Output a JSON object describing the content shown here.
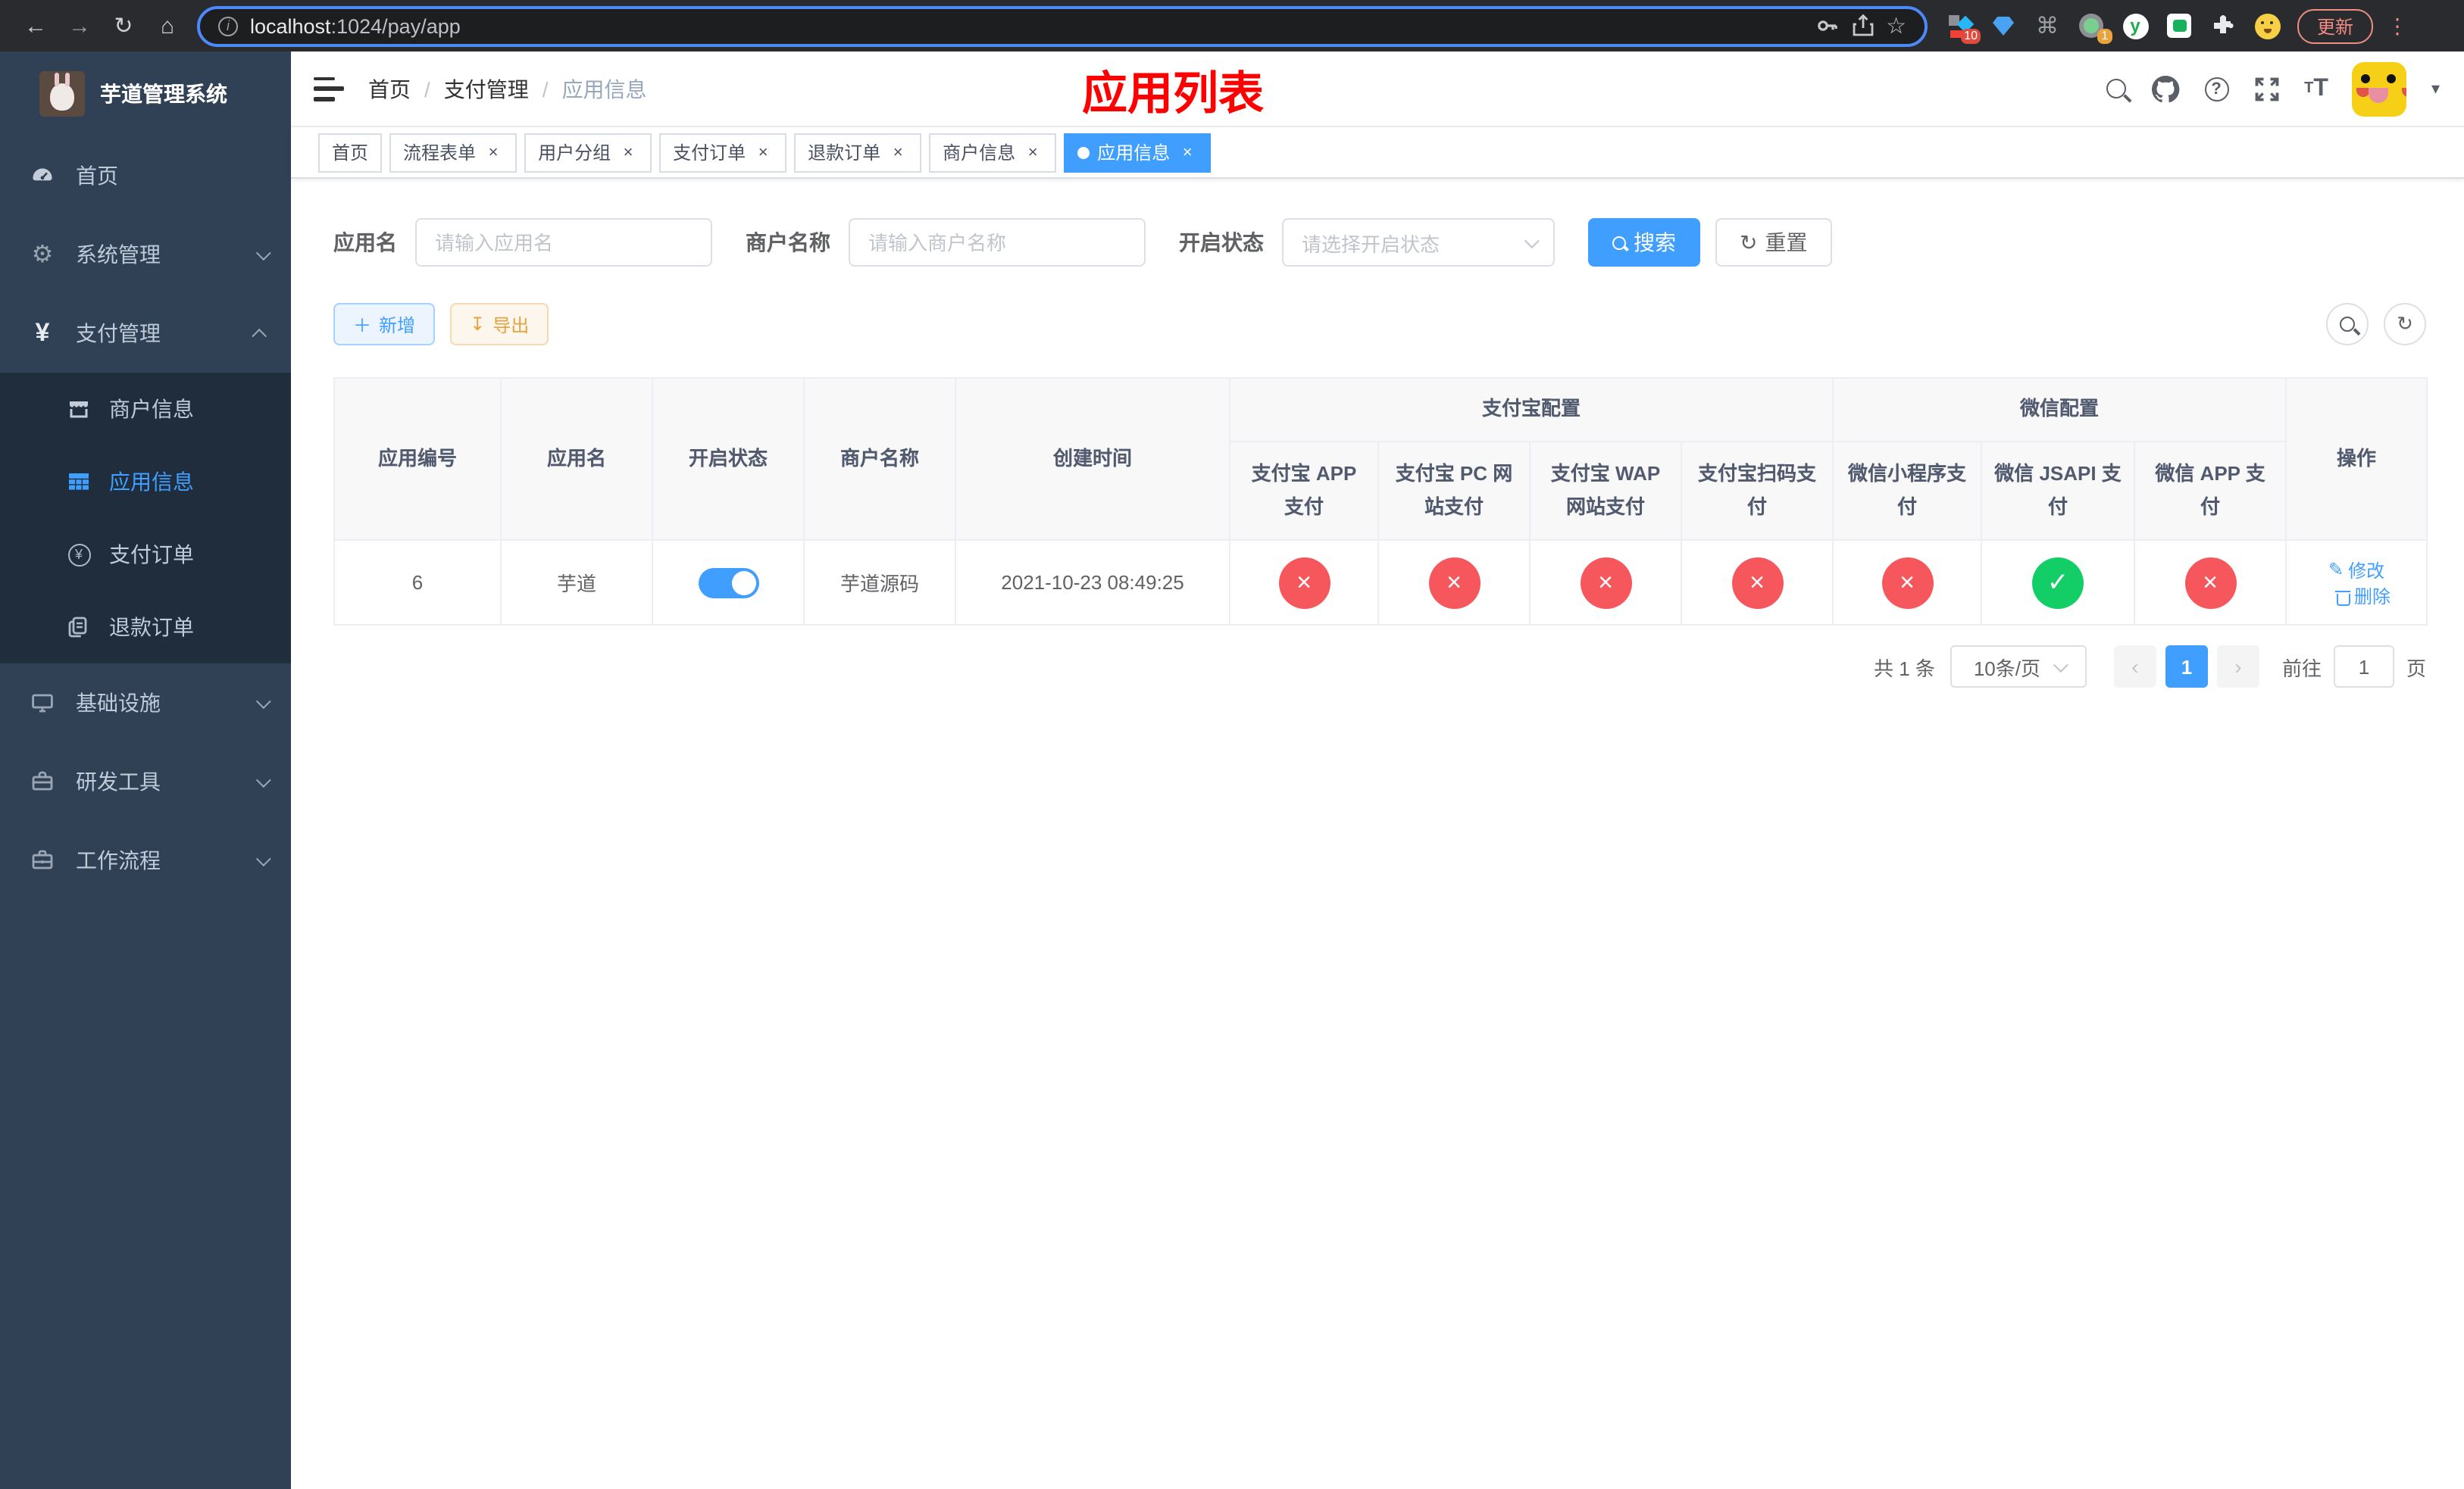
{
  "browser": {
    "url_host": "localhost",
    "url_path": ":1024/pay/app",
    "ext_badge_a": "10",
    "ext_badge_b": "1",
    "ext_y_label": "y",
    "update_label": "更新"
  },
  "icons": {
    "back": "←",
    "forward": "→",
    "reload": "↻",
    "home": "⌂",
    "star": "☆",
    "command": "⌘",
    "menu_dots": "⋮",
    "info": "i",
    "caret_down": "▾",
    "help": "?",
    "prev": "‹",
    "next": "›",
    "close": "×",
    "plus": "＋",
    "download": "↧",
    "refresh": "↻",
    "yen": "¥",
    "gear": "⚙",
    "check": "✓",
    "cross": "×",
    "edit": "✎",
    "crumb_sep": "/"
  },
  "sidebar": {
    "title": "芋道管理系统",
    "items": [
      {
        "label": "首页"
      },
      {
        "label": "系统管理"
      },
      {
        "label": "支付管理"
      },
      {
        "label": "商户信息"
      },
      {
        "label": "应用信息"
      },
      {
        "label": "支付订单"
      },
      {
        "label": "退款订单"
      },
      {
        "label": "基础设施"
      },
      {
        "label": "研发工具"
      },
      {
        "label": "工作流程"
      }
    ]
  },
  "header": {
    "breadcrumb": [
      "首页",
      "支付管理",
      "应用信息"
    ],
    "page_title": "应用列表"
  },
  "tabs": [
    {
      "label": "首页"
    },
    {
      "label": "流程表单"
    },
    {
      "label": "用户分组"
    },
    {
      "label": "支付订单"
    },
    {
      "label": "退款订单"
    },
    {
      "label": "商户信息"
    },
    {
      "label": "应用信息"
    }
  ],
  "filters": {
    "app_name_label": "应用名",
    "app_name_placeholder": "请输入应用名",
    "merchant_label": "商户名称",
    "merchant_placeholder": "请输入商户名称",
    "status_label": "开启状态",
    "status_placeholder": "请选择开启状态",
    "search_label": "搜索",
    "reset_label": "重置"
  },
  "toolbar": {
    "add_label": "新增",
    "export_label": "导出"
  },
  "table": {
    "headers": {
      "app_id": "应用编号",
      "app_name": "应用名",
      "open_status": "开启状态",
      "merchant_name": "商户名称",
      "create_time": "创建时间",
      "alipay_group": "支付宝配置",
      "wechat_group": "微信配置",
      "alipay_app": "支付宝 APP 支付",
      "alipay_pc": "支付宝 PC 网站支付",
      "alipay_wap": "支付宝 WAP 网站支付",
      "alipay_qr": "支付宝扫码支付",
      "wechat_mini": "微信小程序支付",
      "wechat_jsapi": "微信 JSAPI 支付",
      "wechat_app": "微信 APP 支付",
      "actions": "操作"
    },
    "row": {
      "app_id": "6",
      "app_name": "芋道",
      "enabled": true,
      "merchant_name": "芋道源码",
      "create_time": "2021-10-23 08:49:25",
      "statuses": [
        {
          "name": "alipay-app-pay",
          "enabled": false
        },
        {
          "name": "alipay-pc-pay",
          "enabled": false
        },
        {
          "name": "alipay-wap-pay",
          "enabled": false
        },
        {
          "name": "alipay-qr-pay",
          "enabled": false
        },
        {
          "name": "wechat-mini-pay",
          "enabled": false
        },
        {
          "name": "wechat-jsapi-pay",
          "enabled": true
        },
        {
          "name": "wechat-app-pay",
          "enabled": false
        }
      ],
      "edit_label": "修改",
      "delete_label": "删除"
    }
  },
  "pagination": {
    "total": "共 1 条",
    "page_size": "10条/页",
    "current_page": "1",
    "goto_label": "前往",
    "goto_value": "1",
    "page_unit": "页"
  },
  "colors": {
    "accent": "#409eff",
    "danger": "#f6575c",
    "success": "#13ce66",
    "title_red": "#ff0000",
    "sidebar_bg": "#304156",
    "submenu_bg": "#1f2d3d"
  }
}
